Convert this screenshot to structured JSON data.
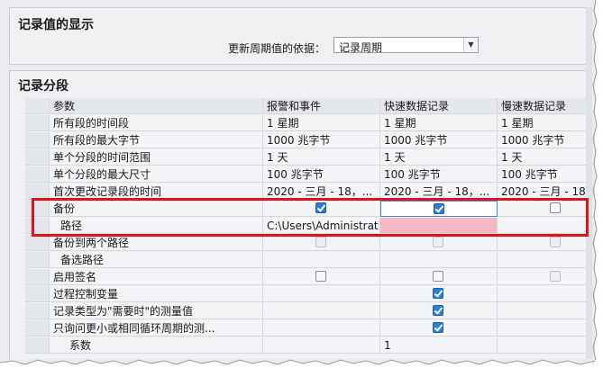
{
  "section1": {
    "title": "记录值的显示",
    "update_label": "更新周期值的依据：",
    "update_value": "记录周期"
  },
  "section2": {
    "title": "记录分段",
    "columns": [
      "参数",
      "报警和事件",
      "快速数据记录",
      "慢速数据记录"
    ],
    "rows": [
      {
        "param": "所有段的时间段",
        "c1": "1 星期",
        "c2": "1 星期",
        "c3": "1 星期"
      },
      {
        "param": "所有段的最大字节",
        "c1": "1000 兆字节",
        "c2": "1000 兆字节",
        "c3": "1000 兆字节"
      },
      {
        "param": "单个分段的时间范围",
        "c1": "1 天",
        "c2": "1 天",
        "c3": "1 天"
      },
      {
        "param": "单个分段的最大尺寸",
        "c1": "100 兆字节",
        "c2": "100 兆字节",
        "c3": "100 兆字节"
      },
      {
        "param": "首次更改记录段的时间",
        "c1": "2020 - 三月 - 18，...",
        "c2": "2020 - 三月 - 18，...",
        "c3": "2020 - 三月 - 18，..."
      },
      {
        "param": "备份"
      },
      {
        "param": "路径",
        "c1": "C:\\Users\\Administrat..."
      },
      {
        "param": "备份到两个路径"
      },
      {
        "param": "备选路径"
      },
      {
        "param": "启用签名"
      },
      {
        "param": "过程控制变量"
      },
      {
        "param": "记录类型为\"需要时\"的测量值"
      },
      {
        "param": "只询问更小或相同循环周期的测..."
      },
      {
        "param": "系数",
        "c2": "1"
      }
    ]
  },
  "checkbox_states": {
    "backup": [
      "checked",
      "checked",
      "unchecked"
    ],
    "backup_two_paths": [
      "disabled",
      "disabled",
      "disabled"
    ],
    "enable_signature": [
      "unchecked",
      "unchecked",
      "disabled"
    ],
    "process_control_vars": [
      "none",
      "checked",
      "none"
    ],
    "on_demand_measurements": [
      "none",
      "checked",
      "none"
    ],
    "smaller_cycle_only": [
      "none",
      "checked",
      "none"
    ]
  },
  "colors": {
    "highlight_box": "#e0131d",
    "checkbox_checked": "#2b7fd4",
    "invalid_cell": "#f5b8c4"
  }
}
